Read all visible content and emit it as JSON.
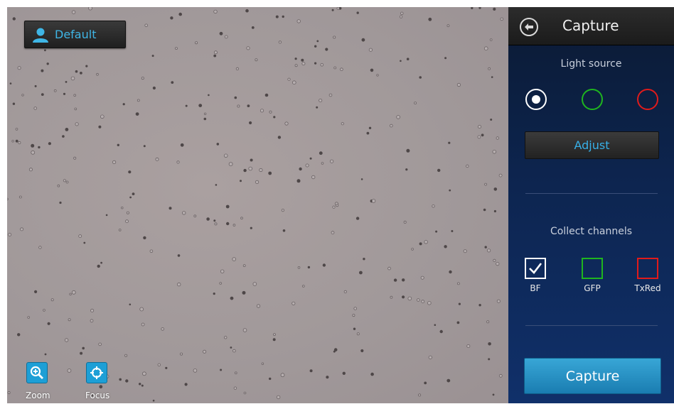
{
  "profile": {
    "label": "Default",
    "icon": "user-icon"
  },
  "tools": [
    {
      "label": "Zoom",
      "icon": "zoom-in-icon"
    },
    {
      "label": "Focus",
      "icon": "crosshair-icon"
    }
  ],
  "panel": {
    "title": "Capture",
    "back_icon": "back-arrow-icon",
    "light_source_label": "Light source",
    "light_sources": [
      {
        "color": "#ffffff",
        "selected": true
      },
      {
        "color": "#1fb51f",
        "selected": false
      },
      {
        "color": "#e01b1b",
        "selected": false
      }
    ],
    "adjust_label": "Adjust",
    "collect_label": "Collect channels",
    "channels": [
      {
        "label": "BF",
        "color": "#ffffff",
        "checked": true
      },
      {
        "label": "GFP",
        "color": "#1fb51f",
        "checked": false
      },
      {
        "label": "TxRed",
        "color": "#e01b1b",
        "checked": false
      }
    ],
    "capture_label": "Capture"
  },
  "colors": {
    "accent": "#37b0e8",
    "capture_button": "#2a94c8",
    "panel_bg": "#0d2550"
  }
}
